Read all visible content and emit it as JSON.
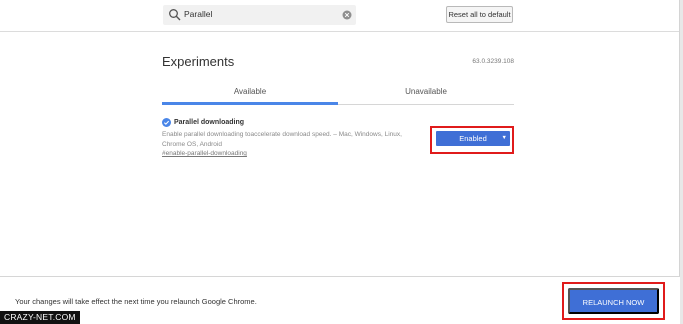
{
  "header": {
    "search_value": "Parallel",
    "reset_label": "Reset all to default"
  },
  "main": {
    "title": "Experiments",
    "version": "63.0.3239.108",
    "tabs": [
      {
        "label": "Available",
        "active": true
      },
      {
        "label": "Unavailable",
        "active": false
      }
    ],
    "experiment": {
      "name": "Parallel downloading",
      "description": "Enable parallel downloading toaccelerate download speed. – Mac, Windows, Linux, Chrome OS, Android",
      "link": "#enable-parallel-downloading",
      "selected_value": "Enabled"
    }
  },
  "footer": {
    "message": "Your changes will take effect the next time you relaunch Google Chrome.",
    "relaunch_label": "RELAUNCH NOW"
  },
  "watermark": "CRAZY-NET.COM",
  "colors": {
    "accent": "#3f6fd6",
    "tab_underline": "#4a86e8",
    "highlight": "#e01b1b"
  },
  "icons": {
    "search": "search-icon",
    "clear": "clear-icon",
    "check": "check-circle-icon",
    "dropdown": "chevron-down-icon"
  }
}
